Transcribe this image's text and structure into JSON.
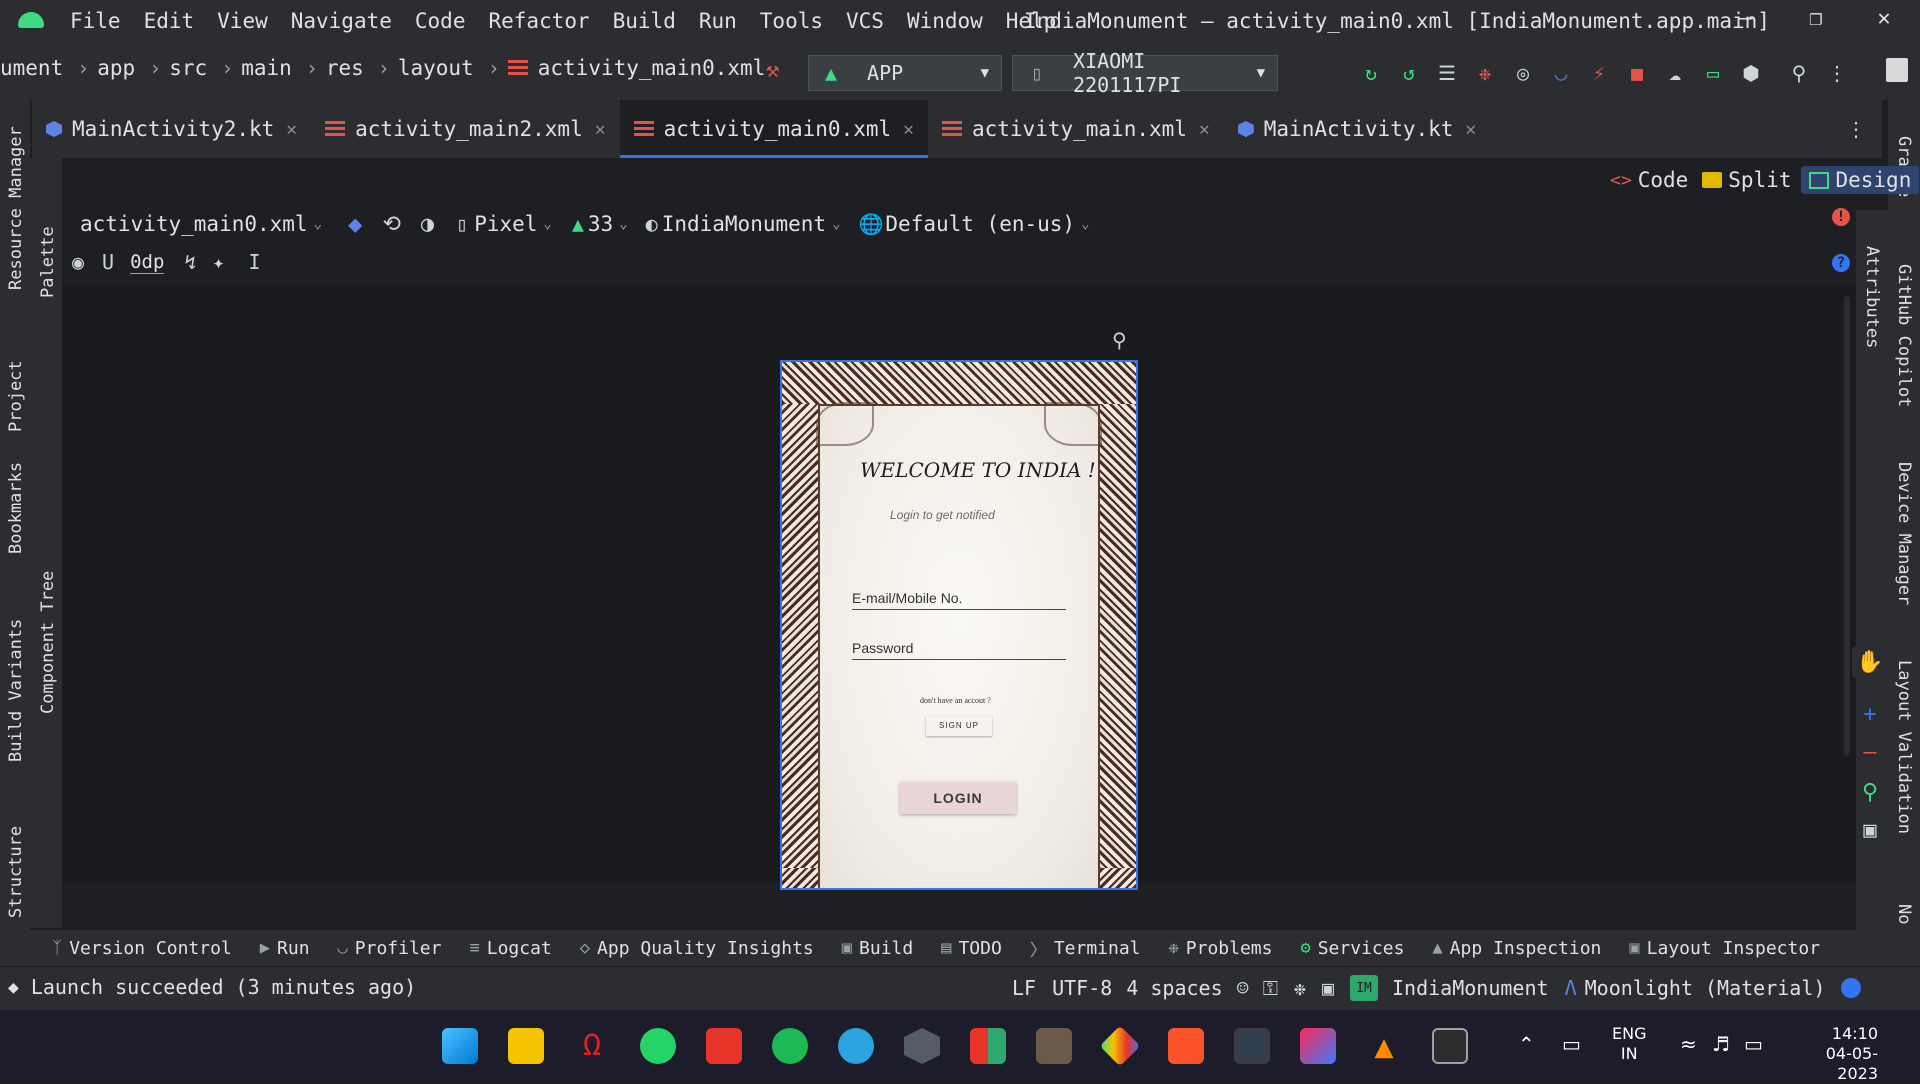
{
  "title_bar": {
    "menu": [
      "File",
      "Edit",
      "View",
      "Navigate",
      "Code",
      "Refactor",
      "Build",
      "Run",
      "Tools",
      "VCS",
      "Window",
      "Help"
    ],
    "title": "IndiaMonument – activity_main0.xml [IndiaMonument.app.main]",
    "buttons": [
      "minimize",
      "restore",
      "close"
    ]
  },
  "nav_bar": {
    "breadcrumbs": [
      "ument",
      "app",
      "src",
      "main",
      "res",
      "layout",
      "activity_main0.xml"
    ],
    "run_config": "APP",
    "device": "XIAOMI 2201117PI"
  },
  "tabs": [
    {
      "label": "MainActivity2.kt",
      "type": "kt",
      "active": false
    },
    {
      "label": "activity_main2.xml",
      "type": "xml",
      "active": false
    },
    {
      "label": "activity_main0.xml",
      "type": "xml",
      "active": true
    },
    {
      "label": "activity_main.xml",
      "type": "xml",
      "active": false
    },
    {
      "label": "MainActivity.kt",
      "type": "kt",
      "active": false
    }
  ],
  "view_modes": {
    "code": "Code",
    "split": "Split",
    "design": "Design",
    "active": "Design"
  },
  "design_toolbar": {
    "file": "activity_main0.xml",
    "device": "Pixel",
    "api": "33",
    "theme": "IndiaMonument",
    "locale": "Default (en-us)",
    "margin": "0dp"
  },
  "left_tool_windows": [
    "Resource Manager",
    "Project",
    "Bookmarks",
    "Build Variants",
    "Structure"
  ],
  "left_tool_windows_2": [
    "Palette",
    "Component Tree"
  ],
  "right_tool_windows": [
    "Gradle",
    "GitHub Copilot",
    "Device Manager",
    "Layout Validation",
    "No"
  ],
  "right_tool_windows_2": [
    "Attributes"
  ],
  "preview": {
    "welcome": "WELCOME TO INDIA !",
    "subtitle": "Login to get notified",
    "email_hint": "E-mail/Mobile No.",
    "password_hint": "Password",
    "no_account": "don't have an accout ?",
    "signup": "SIGN UP",
    "login": "LOGIN"
  },
  "bottom_tools": [
    {
      "label": "Version Control",
      "icon": "branch-icon"
    },
    {
      "label": "Run",
      "icon": "run-icon"
    },
    {
      "label": "Profiler",
      "icon": "profiler-icon"
    },
    {
      "label": "Logcat",
      "icon": "logcat-icon"
    },
    {
      "label": "App Quality Insights",
      "icon": "diamond-icon"
    },
    {
      "label": "Build",
      "icon": "build-icon"
    },
    {
      "label": "TODO",
      "icon": "todo-icon"
    },
    {
      "label": "Terminal",
      "icon": "terminal-icon"
    },
    {
      "label": "Problems",
      "icon": "problems-icon"
    },
    {
      "label": "Services",
      "icon": "services-icon"
    },
    {
      "label": "App Inspection",
      "icon": "inspection-icon"
    },
    {
      "label": "Layout Inspector",
      "icon": "layout-inspector-icon"
    }
  ],
  "status_bar": {
    "message": "Launch succeeded (3 minutes ago)",
    "line_sep": "LF",
    "encoding": "UTF-8",
    "indent": "4 spaces",
    "project_badge": "IM",
    "project": "IndiaMonument",
    "theme": "Moonlight (Material)"
  },
  "taskbar": {
    "lang": "ENG",
    "region": "IN",
    "time": "14:10",
    "date": "04-05-2023"
  },
  "colors": {
    "accent": "#3574f0",
    "error": "#e5534b",
    "bg": "#1e1f22",
    "panel": "#2b2d30"
  }
}
